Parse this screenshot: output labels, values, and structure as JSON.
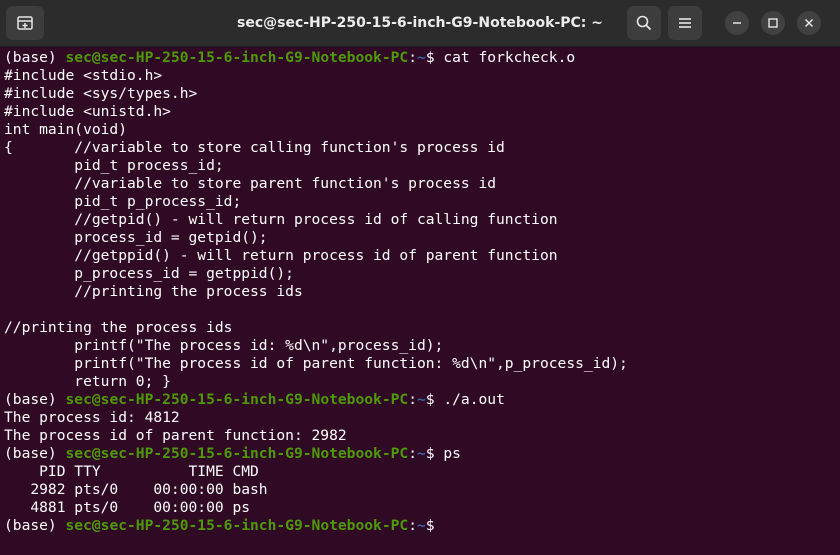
{
  "window": {
    "title": "sec@sec-HP-250-15-6-inch-G9-Notebook-PC: ~"
  },
  "colors": {
    "background": "#300a24",
    "titlebar": "#2c2c2c",
    "prompt_user": "#4e9a06",
    "prompt_dir": "#3465a4",
    "text": "#ffffff"
  },
  "icons": {
    "new_tab": "new-tab-icon",
    "search": "search-icon",
    "menu": "hamburger-menu-icon",
    "minimize": "minimize-icon",
    "maximize": "maximize-icon",
    "close": "close-icon"
  },
  "prompt": {
    "env": "(base) ",
    "user_host": "sec@sec-HP-250-15-6-inch-G9-Notebook-PC",
    "colon": ":",
    "dir": "~",
    "symbol": "$ "
  },
  "terminal": {
    "lines": [
      {
        "type": "prompt",
        "command": "cat forkcheck.o"
      },
      {
        "type": "out",
        "text": "#include <stdio.h>"
      },
      {
        "type": "out",
        "text": "#include <sys/types.h>"
      },
      {
        "type": "out",
        "text": "#include <unistd.h>"
      },
      {
        "type": "out",
        "text": "int main(void)"
      },
      {
        "type": "out",
        "text": "{       //variable to store calling function's process id"
      },
      {
        "type": "out",
        "text": "        pid_t process_id;"
      },
      {
        "type": "out",
        "text": "        //variable to store parent function's process id"
      },
      {
        "type": "out",
        "text": "        pid_t p_process_id;"
      },
      {
        "type": "out",
        "text": "        //getpid() - will return process id of calling function"
      },
      {
        "type": "out",
        "text": "        process_id = getpid();"
      },
      {
        "type": "out",
        "text": "        //getppid() - will return process id of parent function"
      },
      {
        "type": "out",
        "text": "        p_process_id = getppid();"
      },
      {
        "type": "out",
        "text": "        //printing the process ids"
      },
      {
        "type": "out",
        "text": ""
      },
      {
        "type": "out",
        "text": "//printing the process ids"
      },
      {
        "type": "out",
        "text": "        printf(\"The process id: %d\\n\",process_id);"
      },
      {
        "type": "out",
        "text": "        printf(\"The process id of parent function: %d\\n\",p_process_id);"
      },
      {
        "type": "out",
        "text": "        return 0; }"
      },
      {
        "type": "prompt",
        "command": "./a.out"
      },
      {
        "type": "out",
        "text": "The process id: 4812"
      },
      {
        "type": "out",
        "text": "The process id of parent function: 2982"
      },
      {
        "type": "prompt",
        "command": "ps"
      },
      {
        "type": "out",
        "text": "    PID TTY          TIME CMD"
      },
      {
        "type": "out",
        "text": "   2982 pts/0    00:00:00 bash"
      },
      {
        "type": "out",
        "text": "   4881 pts/0    00:00:00 ps"
      },
      {
        "type": "prompt",
        "command": "",
        "cursor": true
      }
    ]
  }
}
